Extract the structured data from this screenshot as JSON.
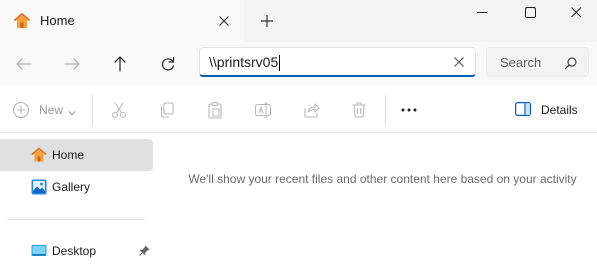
{
  "tab": {
    "title": "Home",
    "icon": "home-icon"
  },
  "address": {
    "value": "\\\\printsrv05"
  },
  "search": {
    "placeholder": "Search"
  },
  "toolbar": {
    "new_label": "New",
    "details_label": "Details",
    "items": [
      "cut-icon",
      "copy-icon",
      "paste-icon",
      "rename-icon",
      "share-icon",
      "delete-icon",
      "more-icon"
    ]
  },
  "sidebar": {
    "items": [
      {
        "label": "Home",
        "icon": "home-icon",
        "selected": true
      },
      {
        "label": "Gallery",
        "icon": "gallery-icon",
        "selected": false
      },
      {
        "label": "Desktop",
        "icon": "desktop-icon",
        "selected": false,
        "pinned": true
      }
    ]
  },
  "main": {
    "empty_message": "We'll show your recent files and other content here based on your activity"
  },
  "colors": {
    "accent": "#005fb8",
    "home_orange": "#f7a13a",
    "gallery_blue": "#1e88e5",
    "desktop_blue": "#29a3e0"
  }
}
